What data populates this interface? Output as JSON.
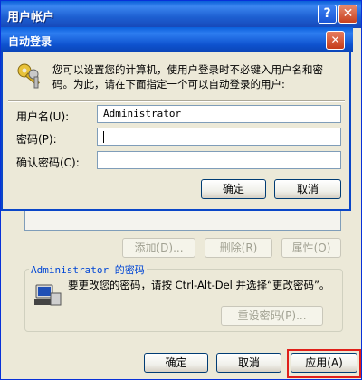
{
  "outer_window": {
    "title": "用户帐户",
    "help_label": "?",
    "close_label": "✕",
    "buttons": {
      "add": "添加(D)...",
      "remove": "删除(R)",
      "properties": "属性(O)"
    },
    "password_group": {
      "title": "Administrator 的密码",
      "text": "要更改您的密码，请按 Ctrl-Alt-Del 并选择“更改密码”。",
      "reset_button": "重设密码(P)..."
    },
    "footer": {
      "ok": "确定",
      "cancel": "取消",
      "apply": "应用(A)"
    }
  },
  "dialog": {
    "title": "自动登录",
    "close_label": "✕",
    "description": "您可以设置您的计算机，使用户登录时不必键入用户名和密码。为此，请在下面指定一个可以自动登录的用户:",
    "fields": {
      "username_label": "用户名(U):",
      "username_value": "Administrator",
      "password_label": "密码(P):",
      "password_value": "",
      "confirm_label": "确认密码(C):",
      "confirm_value": ""
    },
    "ok": "确定",
    "cancel": "取消"
  },
  "colors": {
    "titlebar": "#1d5fd1",
    "window_bg": "#ece9d8",
    "highlight": "#e0201a",
    "group_title": "#0046d5"
  }
}
